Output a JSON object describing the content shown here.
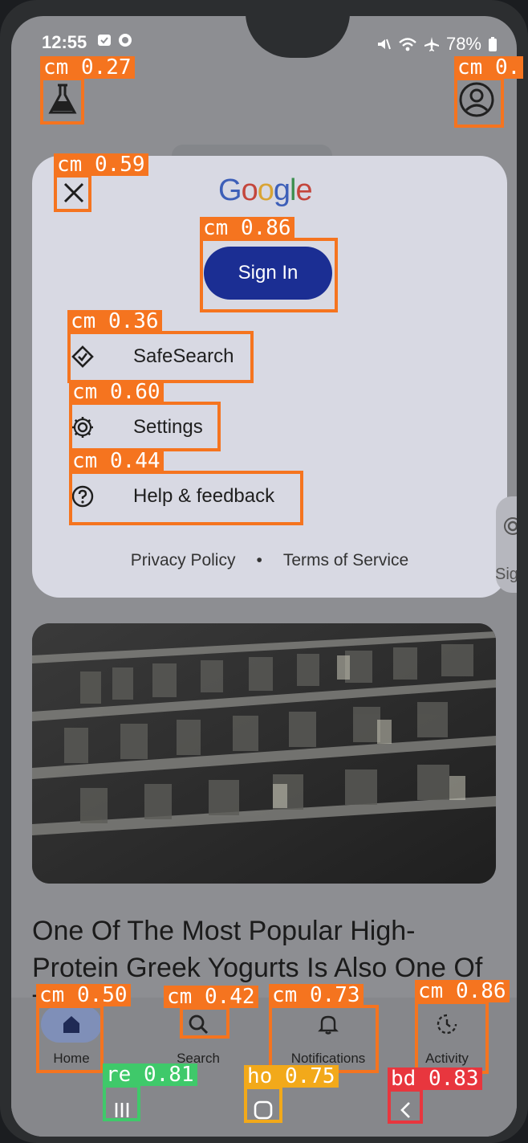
{
  "status_bar": {
    "time": "12:55",
    "battery": "78%"
  },
  "sheet": {
    "logo": [
      "G",
      "o",
      "o",
      "g",
      "l",
      "e"
    ],
    "logo_colors": [
      "#3d5fb8",
      "#c4463c",
      "#d9a434",
      "#3d5fb8",
      "#3c8f4f",
      "#c4463c"
    ],
    "sign_in": "Sign In",
    "menu": [
      {
        "label": "SafeSearch",
        "icon": "safesearch-icon"
      },
      {
        "label": "Settings",
        "icon": "gear-icon"
      },
      {
        "label": "Help & feedback",
        "icon": "help-icon"
      }
    ],
    "privacy": "Privacy Policy",
    "separator": "•",
    "terms": "Terms of Service"
  },
  "peek_label": "Sig",
  "article": {
    "headline": "One Of The Most Popular High-Protein Greek Yogurts Is Also One Of The W..."
  },
  "bottom_nav": {
    "home": "Home",
    "search": "Search",
    "notifications": "Notifications",
    "activity": "Activity"
  },
  "detections": [
    {
      "label": "cm 0.27"
    },
    {
      "label": "cm 0.",
      "note": "cut off at right edge"
    },
    {
      "label": "cm 0.59"
    },
    {
      "label": "cm 0.86"
    },
    {
      "label": "cm 0.36"
    },
    {
      "label": "cm 0.60"
    },
    {
      "label": "cm 0.44"
    },
    {
      "label": "cm 0.50"
    },
    {
      "label": "cm 0.42"
    },
    {
      "label": "cm 0.73"
    },
    {
      "label": "cm 0.86"
    },
    {
      "label": "re 0.81"
    },
    {
      "label": "ho 0.75"
    },
    {
      "label": "bd 0.83"
    }
  ],
  "colors": {
    "accent": "#1b2e93",
    "detection": "#f5741f"
  }
}
